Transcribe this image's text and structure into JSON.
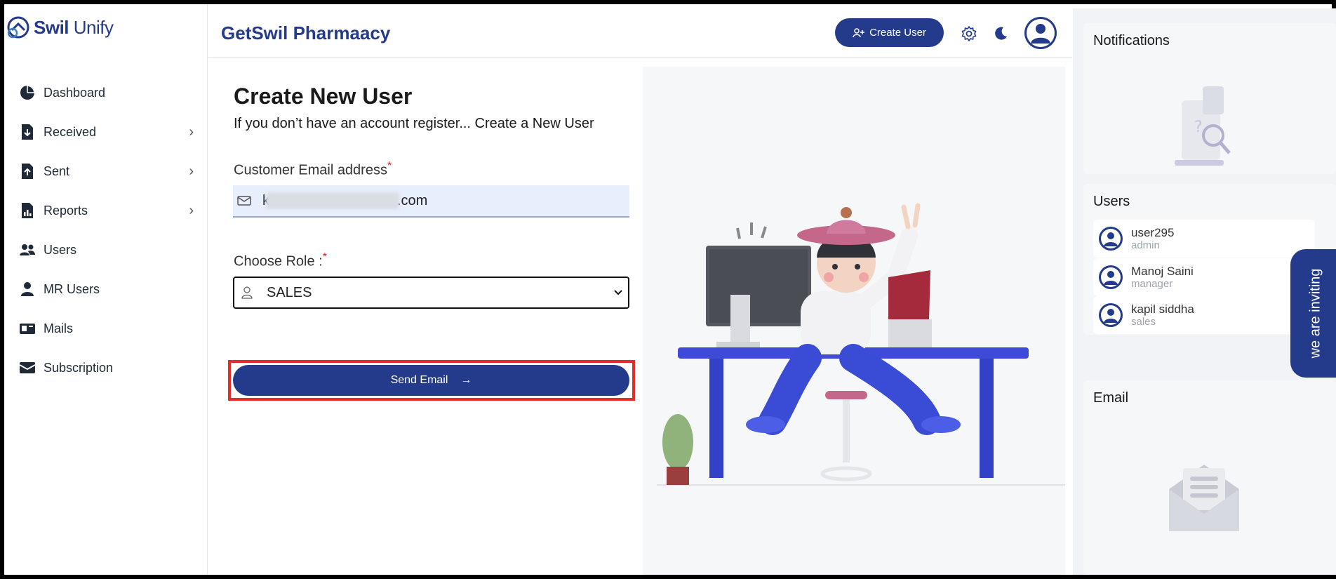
{
  "logo": {
    "brand_part1": "Swil",
    "brand_part2": " Unify"
  },
  "sidebar": {
    "items": [
      {
        "label": "Dashboard",
        "icon": "pie-chart-icon",
        "has_submenu": false
      },
      {
        "label": "Received",
        "icon": "download-file-icon",
        "has_submenu": true
      },
      {
        "label": "Sent",
        "icon": "upload-file-icon",
        "has_submenu": true
      },
      {
        "label": "Reports",
        "icon": "report-icon",
        "has_submenu": true
      },
      {
        "label": "Users",
        "icon": "users-icon",
        "has_submenu": false
      },
      {
        "label": "MR Users",
        "icon": "user-icon",
        "has_submenu": false
      },
      {
        "label": "Mails",
        "icon": "mailbox-icon",
        "has_submenu": false
      },
      {
        "label": "Subscription",
        "icon": "subscription-icon",
        "has_submenu": false
      }
    ]
  },
  "header": {
    "title": "GetSwil Pharmaacy",
    "create_user_label": "Create User"
  },
  "form": {
    "title": "Create New User",
    "subtitle": "If you don’t have an account register... Create a New User",
    "email_label": "Customer Email address",
    "email_value_prefix": "k",
    "email_value_suffix": ".com",
    "role_label": "Choose Role :",
    "required_mark": "*",
    "role_value": "SALES",
    "send_label": "Send Email",
    "send_arrow": "→"
  },
  "right_panel": {
    "notifications_title": "Notifications",
    "users_title": "Users",
    "users": [
      {
        "name": "user295",
        "role": "admin"
      },
      {
        "name": "Manoj Saini",
        "role": "manager"
      },
      {
        "name": "kapil siddha",
        "role": "sales"
      }
    ],
    "email_title": "Email",
    "invite_label": "we are inviting"
  },
  "colors": {
    "brand": "#243a8a",
    "highlight": "#e62b2b",
    "field_bg": "#e8effc"
  }
}
